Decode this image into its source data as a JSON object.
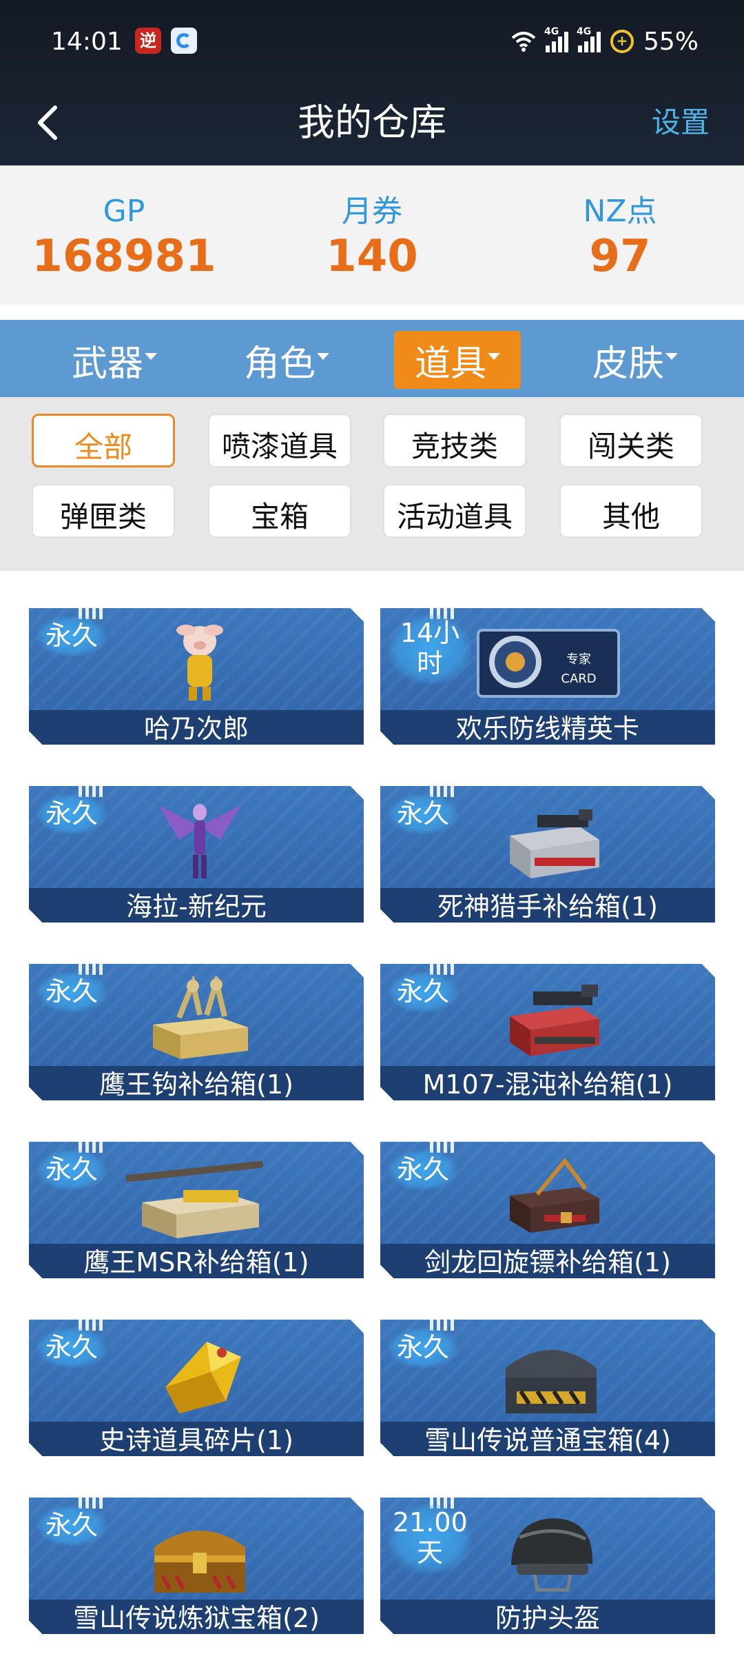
{
  "status_bar": {
    "time": "14:01",
    "battery": "55%",
    "net1": "4G",
    "net2": "4G"
  },
  "header": {
    "title": "我的仓库",
    "settings_label": "设置"
  },
  "currency": [
    {
      "label": "GP",
      "value": "168981"
    },
    {
      "label": "月券",
      "value": "140"
    },
    {
      "label": "NZ点",
      "value": "97"
    }
  ],
  "tabs": [
    {
      "label": "武器",
      "active": false
    },
    {
      "label": "角色",
      "active": false
    },
    {
      "label": "道具",
      "active": true
    },
    {
      "label": "皮肤",
      "active": false
    }
  ],
  "filters": [
    {
      "label": "全部",
      "active": true
    },
    {
      "label": "喷漆道具"
    },
    {
      "label": "竞技类"
    },
    {
      "label": "闯关类"
    },
    {
      "label": "弹匣类"
    },
    {
      "label": "宝箱"
    },
    {
      "label": "活动道具"
    },
    {
      "label": "其他"
    }
  ],
  "items": [
    {
      "badge": "永久",
      "name": "哈乃次郎",
      "icon": "pig-character-icon"
    },
    {
      "badge": "14小时",
      "badge_l1": "14小",
      "badge_l2": "时",
      "name": "欢乐防线精英卡",
      "icon": "expert-card-icon",
      "card_text_1": "专家",
      "card_text_2": "CARD"
    },
    {
      "badge": "永久",
      "name": "海拉-新纪元",
      "icon": "winged-character-icon"
    },
    {
      "badge": "永久",
      "name": "死神猎手补给箱(1)",
      "icon": "weapon-crate-icon"
    },
    {
      "badge": "永久",
      "name": "鹰王钩补给箱(1)",
      "icon": "gold-crate-icon"
    },
    {
      "badge": "永久",
      "name": "M107-混沌补给箱(1)",
      "icon": "weapon-crate-icon"
    },
    {
      "badge": "永久",
      "name": "鹰王MSR补给箱(1)",
      "icon": "rifle-crate-icon"
    },
    {
      "badge": "永久",
      "name": "剑龙回旋镖补给箱(1)",
      "icon": "dark-crate-icon"
    },
    {
      "badge": "永久",
      "name": "史诗道具碎片(1)",
      "icon": "gold-fragment-icon"
    },
    {
      "badge": "永久",
      "name": "雪山传说普通宝箱(4)",
      "icon": "metal-chest-icon"
    },
    {
      "badge": "永久",
      "name": "雪山传说炼狱宝箱(2)",
      "icon": "treasure-chest-icon"
    },
    {
      "badge": "21.00天",
      "badge_l1": "21.00",
      "badge_l2": "天",
      "name": "防护头盔",
      "icon": "helmet-icon"
    }
  ]
}
